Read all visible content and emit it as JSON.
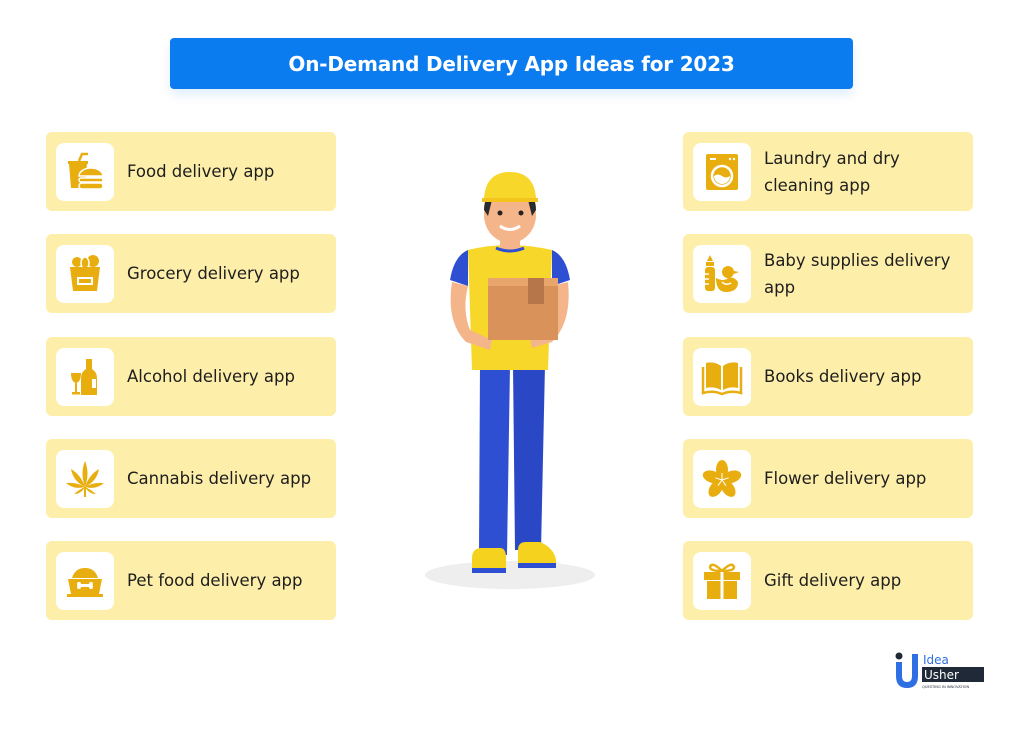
{
  "title": "On-Demand Delivery App Ideas for 2023",
  "colors": {
    "title_bg": "#0a7cf0",
    "card_bg": "#fdeeaa",
    "icon_color": "#e8ae10",
    "text": "#1e1e1e"
  },
  "left_items": [
    {
      "label": "Food delivery app",
      "icon": "food-icon"
    },
    {
      "label": "Grocery delivery app",
      "icon": "grocery-bag-icon"
    },
    {
      "label": "Alcohol delivery app",
      "icon": "wine-bottle-icon"
    },
    {
      "label": "Cannabis delivery app",
      "icon": "cannabis-leaf-icon"
    },
    {
      "label": "Pet food delivery app",
      "icon": "pet-bowl-icon"
    }
  ],
  "right_items": [
    {
      "label": "Laundry and dry cleaning app",
      "icon": "washing-machine-icon"
    },
    {
      "label": "Baby supplies delivery app",
      "icon": "baby-bottle-duck-icon"
    },
    {
      "label": "Books delivery app",
      "icon": "open-book-icon"
    },
    {
      "label": "Flower delivery app",
      "icon": "flower-icon"
    },
    {
      "label": "Gift delivery app",
      "icon": "gift-box-icon"
    }
  ],
  "logo": {
    "line1": "Idea",
    "line2": "Usher",
    "tagline": "QUESTING IN INNOVATION"
  }
}
